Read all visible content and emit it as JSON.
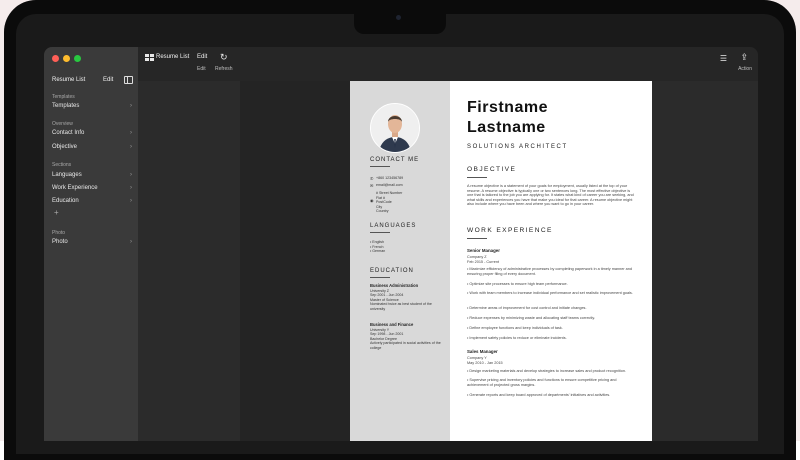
{
  "colors": {
    "traffic_red": "#ff5f57",
    "traffic_yellow": "#febc2e",
    "traffic_green": "#28c840",
    "sidebar_bg": "#3a3a3a",
    "page_left_bg": "#d9d9d9"
  },
  "sidebar": {
    "title": "Resume List",
    "edit": "Edit",
    "sections": [
      {
        "label": "Templates",
        "items": [
          "Templates"
        ]
      },
      {
        "label": "Overview",
        "items": [
          "Contact Info",
          "Objective"
        ]
      },
      {
        "label": "Sections",
        "items": [
          "Languages",
          "Work Experience",
          "Education"
        ]
      },
      {
        "label": "Photo",
        "items": [
          "Photo"
        ]
      }
    ],
    "add_symbol": "+"
  },
  "toolbar": {
    "title": "Resume List",
    "edit": "Edit",
    "edit_label": "Edit",
    "refresh_label": "Refresh",
    "action_label": "Action",
    "refresh_icon": "↻",
    "list_icon": "☰",
    "share_icon": "⇪"
  },
  "resume": {
    "first_name": "Firstname",
    "last_name": "Lastname",
    "job_title": "SOLUTIONS ARCHITECT",
    "contact_heading": "CONTACT ME",
    "phone": "+860 123456789",
    "email": "email@mail.com",
    "address": [
      "# Street Number",
      "Flat #",
      "PostCode",
      "City",
      "Country"
    ],
    "languages_heading": "LANGUAGES",
    "languages": [
      "• English",
      "• French",
      "• German"
    ],
    "education_heading": "EDUCATION",
    "education": [
      {
        "degree": "Business Administration",
        "school": "University Z",
        "dates": "Sep 2001 - Jun 2004",
        "qual": "Master of Science",
        "note": "Nominated twice as best student of the university"
      },
      {
        "degree": "Business and Finance",
        "school": "University Y",
        "dates": "Sep 1998 - Jun 2001",
        "qual": "Bachelor Degree",
        "note": "Actively participated in social activities of the college"
      }
    ],
    "objective_heading": "OBJECTIVE",
    "objective_text": "A resume objective is a statement of your goals for employment, usually listed at the top of your resume. A resume objective is typically one or two sentences long. The most effective objective is one that is tailored to the job you are applying for. It states what kind of career you are seeking, and what skills and experiences you have that make you ideal for that career. A resume objective might also include where you have been and where you want to go in your career.",
    "work_heading": "WORK EXPERIENCE",
    "jobs": [
      {
        "role": "Senior Manager",
        "company": "Company Z",
        "dates": "Feb 2015 - Current",
        "bullets": [
          "• Maximize efficiency of administrative processes by completing paperwork in a timely manner and ensuring proper filing of every document.",
          "• Optimize site processes to ensure high team performance.",
          "• Work with team members to increase individual performance and set realistic improvement goals.",
          "• Determine areas of improvement for cost control and initiate changes.",
          "• Reduce expenses by minimizing waste and allocating staff teams correctly.",
          "• Define employee functions and keep individuals of task.",
          "• Implement safety policies to reduce or eliminate incidents."
        ]
      },
      {
        "role": "Sales Manager",
        "company": "Company Y",
        "dates": "May 2010 - Jan 2015",
        "bullets": [
          "• Design marketing materials and develop strategies to increase sales and product recognition.",
          "• Supervise pricing and inventory policies and functions to ensure competitive pricing and achievement of projected gross margins.",
          "• Generate reports and keep board approved of departments' initiatives and activities."
        ]
      }
    ]
  }
}
